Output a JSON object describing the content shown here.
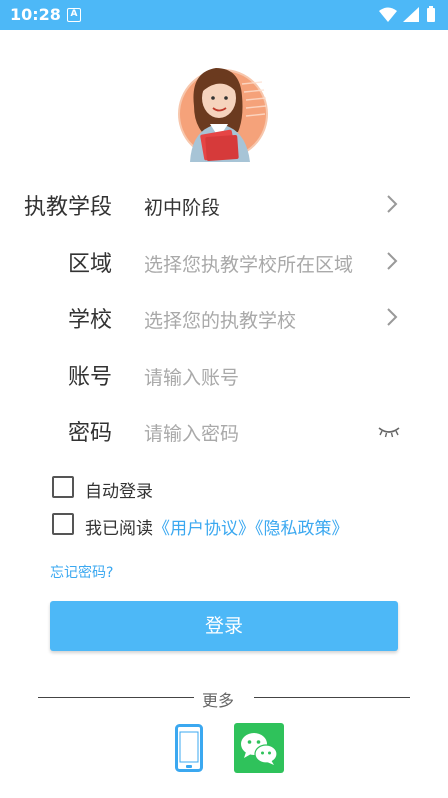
{
  "status_bar": {
    "time": "10:28",
    "notification_letter": "A",
    "bg_color": "#4db8f7"
  },
  "avatar": {
    "icon": "teacher-avatar"
  },
  "form": {
    "rows": [
      {
        "label": "执教学段",
        "value": "初中阶段",
        "is_placeholder": false,
        "trailing_icon": "chevron-right-icon"
      },
      {
        "label": "区域",
        "value": "选择您执教学校所在区域",
        "is_placeholder": true,
        "trailing_icon": "chevron-right-icon"
      },
      {
        "label": "学校",
        "value": "选择您的执教学校",
        "is_placeholder": true,
        "trailing_icon": "chevron-right-icon"
      },
      {
        "label": "账号",
        "value": "请输入账号",
        "is_placeholder": true
      },
      {
        "label": "密码",
        "value": "请输入密码",
        "is_placeholder": true,
        "trailing_icon": "eye-closed-icon"
      }
    ]
  },
  "checkboxes": {
    "auto_login": {
      "label": "自动登录",
      "checked": false
    },
    "agreement": {
      "prefix": "我已阅读",
      "user_agreement": "《用户协议》",
      "privacy_policy": "《隐私政策》",
      "checked": false
    }
  },
  "forgot_password": "忘记密码?",
  "login_button": "登录",
  "more": {
    "label": "更多",
    "options": [
      {
        "icon": "phone-icon",
        "color": "#3ba8f0"
      },
      {
        "icon": "wechat-icon",
        "color": "#2fc25b"
      }
    ]
  },
  "colors": {
    "accent": "#4db8f7",
    "link": "#3ba8f0",
    "wechat": "#2fc25b"
  }
}
